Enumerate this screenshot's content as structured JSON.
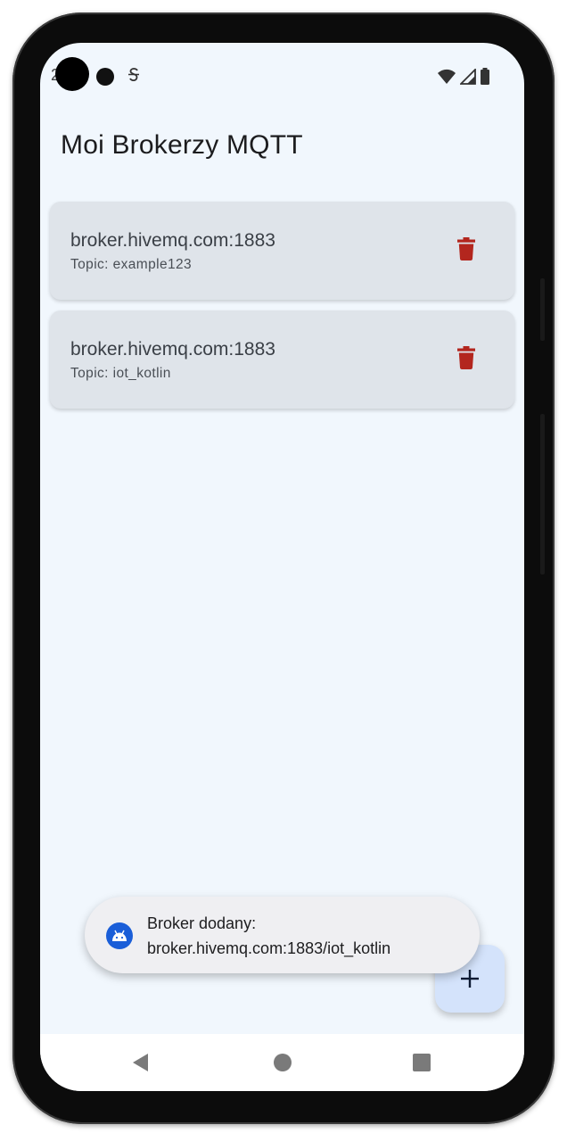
{
  "status_bar": {
    "time": "2",
    "icons": [
      "s-notification-icon",
      "wifi-icon",
      "cellular-signal-icon",
      "battery-icon"
    ]
  },
  "app": {
    "title": "Moi Brokerzy MQTT"
  },
  "brokers": [
    {
      "host": "broker.hivemq.com:1883",
      "topic": "Topic: example123"
    },
    {
      "host": "broker.hivemq.com:1883",
      "topic": "Topic: iot_kotlin"
    }
  ],
  "toast": {
    "line1": "Broker dodany:",
    "line2": "broker.hivemq.com:1883/iot_kotlin",
    "icon": "android-icon"
  },
  "fab": {
    "label": "+",
    "icon": "plus-icon"
  },
  "navigation": {
    "buttons": [
      "back-icon",
      "home-icon",
      "recents-icon"
    ]
  },
  "colors": {
    "screen_bg": "#f1f7fd",
    "card_bg": "#dfe4ea",
    "delete": "#b3261e",
    "fab_bg": "#d4e3fb",
    "toast_icon_bg": "#1a5ed8"
  }
}
